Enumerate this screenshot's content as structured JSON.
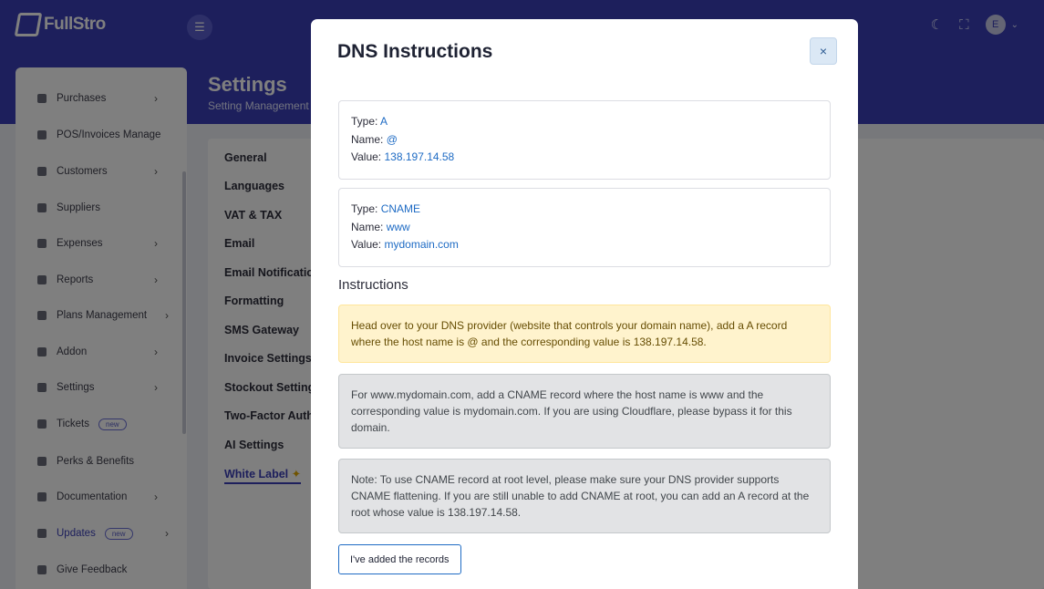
{
  "app": {
    "logo_text": "FullStro"
  },
  "topbar": {
    "avatar_initial": "E"
  },
  "sidebar": {
    "items": [
      {
        "label": "Purchases",
        "chevron": true,
        "badge": ""
      },
      {
        "label": "POS/Invoices Manage",
        "chevron": false,
        "badge": ""
      },
      {
        "label": "Customers",
        "chevron": true,
        "badge": ""
      },
      {
        "label": "Suppliers",
        "chevron": false,
        "badge": ""
      },
      {
        "label": "Expenses",
        "chevron": true,
        "badge": ""
      },
      {
        "label": "Reports",
        "chevron": true,
        "badge": ""
      },
      {
        "label": "Plans Management",
        "chevron": true,
        "badge": ""
      },
      {
        "label": "Addon",
        "chevron": true,
        "badge": ""
      },
      {
        "label": "Settings",
        "chevron": true,
        "badge": ""
      },
      {
        "label": "Tickets",
        "chevron": false,
        "badge": "new"
      },
      {
        "label": "Perks & Benefits",
        "chevron": false,
        "badge": ""
      },
      {
        "label": "Documentation",
        "chevron": true,
        "badge": ""
      },
      {
        "label": "Updates",
        "chevron": true,
        "badge": "new"
      },
      {
        "label": "Give Feedback",
        "chevron": false,
        "badge": ""
      }
    ]
  },
  "page": {
    "title": "Settings",
    "subtitle": "Setting Management"
  },
  "settings_menu": {
    "items": [
      "General",
      "Languages",
      "VAT & TAX",
      "Email",
      "Email Notification",
      "Formatting",
      "SMS Gateway",
      "Invoice Settings",
      "Stockout Settings",
      "Two-Factor Auth",
      "AI Settings",
      "White Label"
    ]
  },
  "modal": {
    "title": "DNS Instructions",
    "close_label": "×",
    "records": [
      {
        "type_label": "Type:",
        "type": "A",
        "name_label": "Name:",
        "name": "@",
        "value_label": "Value:",
        "value": "138.197.14.58"
      },
      {
        "type_label": "Type:",
        "type": "CNAME",
        "name_label": "Name:",
        "name": "www",
        "value_label": "Value:",
        "value": "mydomain.com"
      }
    ],
    "instructions_heading": "Instructions",
    "instructions": [
      "Head over to your DNS provider (website that controls your domain name), add a A record where the host name is @ and the corresponding value is 138.197.14.58.",
      "For www.mydomain.com, add a CNAME record where the host name is www and the corresponding value is mydomain.com. If you are using Cloudflare, please bypass it for this domain.",
      "Note: To use CNAME record at root level, please make sure your DNS provider supports CNAME flattening. If you are still unable to add CNAME at root, you can add an A record at the root whose value is 138.197.14.58."
    ],
    "confirm_button": "I've added the records"
  }
}
